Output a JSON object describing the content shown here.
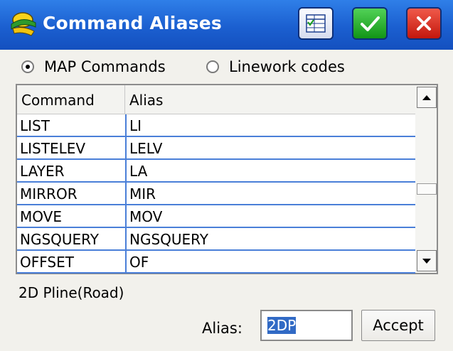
{
  "window": {
    "title": "Command Aliases",
    "buttons": {
      "grid_icon": "table-icon",
      "ok_icon": "checkmark-icon",
      "cancel_icon": "close-icon"
    },
    "colors": {
      "titlebar": "#1b5fd0",
      "ok": "#1a9d1f",
      "cancel": "#d21d12"
    }
  },
  "mode": {
    "options": [
      {
        "label": "MAP Commands",
        "selected": true
      },
      {
        "label": "Linework codes",
        "selected": false
      }
    ]
  },
  "table": {
    "columns": [
      "Command",
      "Alias"
    ],
    "rows": [
      {
        "command": "LIST",
        "alias": "LI"
      },
      {
        "command": "LISTELEV",
        "alias": "LELV"
      },
      {
        "command": "LAYER",
        "alias": "LA"
      },
      {
        "command": "MIRROR",
        "alias": "MIR"
      },
      {
        "command": "MOVE",
        "alias": "MOV"
      },
      {
        "command": "NGSQUERY",
        "alias": "NGSQUERY"
      },
      {
        "command": "OFFSET",
        "alias": "OF"
      }
    ]
  },
  "status_text": "2D Pline(Road)",
  "alias_field": {
    "label": "Alias:",
    "value": "2DP"
  },
  "accept_label": "Accept"
}
